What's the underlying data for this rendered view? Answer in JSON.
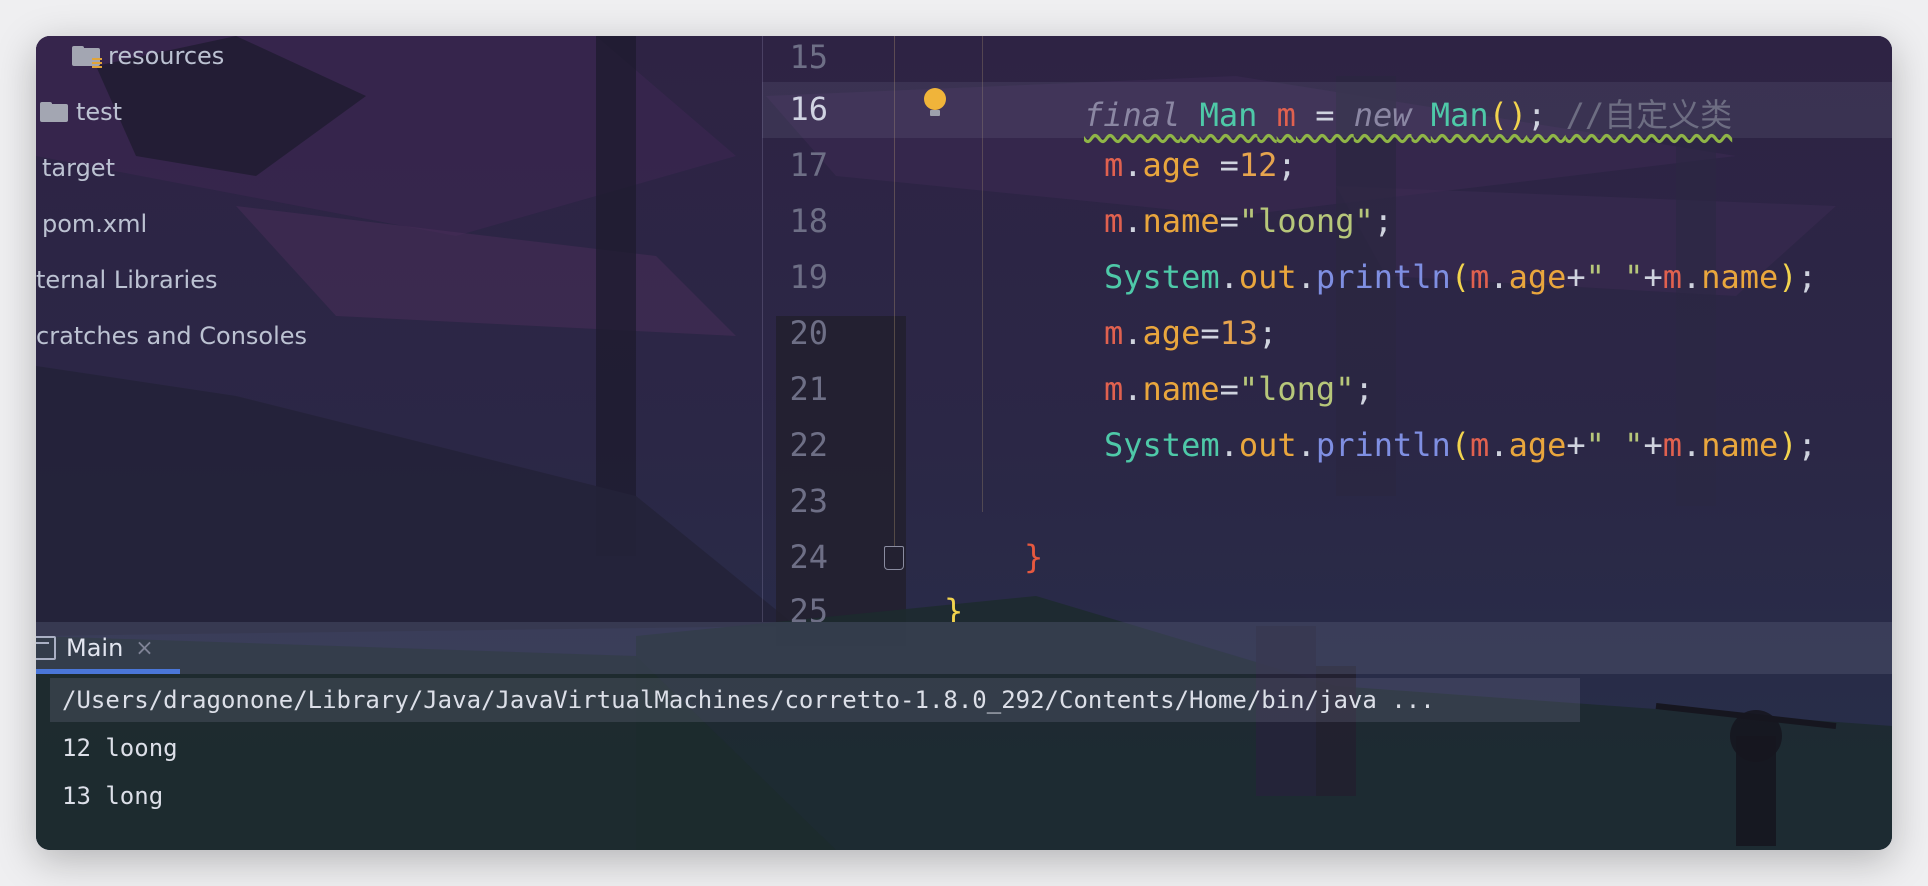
{
  "project_tree": {
    "items": [
      {
        "label": "resources",
        "icon": "resources-folder-icon"
      },
      {
        "label": "test",
        "icon": "folder-icon"
      },
      {
        "label": "target",
        "icon": ""
      },
      {
        "label": "pom.xml",
        "icon": ""
      },
      {
        "label": "ternal Libraries",
        "icon": ""
      },
      {
        "label": "cratches and Consoles",
        "icon": ""
      }
    ]
  },
  "editor": {
    "current_line": "16",
    "lines": [
      {
        "num": "15"
      },
      {
        "num": "16",
        "tokens": [
          "final",
          " ",
          "Man",
          " ",
          "m",
          " = ",
          "new",
          " ",
          "Man",
          "()",
          "; ",
          "//自定义类"
        ]
      },
      {
        "num": "17",
        "tokens": [
          "m",
          ".",
          "age",
          " =",
          "12",
          ";"
        ]
      },
      {
        "num": "18",
        "tokens": [
          "m",
          ".",
          "name",
          "=",
          "\"loong\"",
          ";"
        ]
      },
      {
        "num": "19",
        "tokens": [
          "System",
          ".",
          "out",
          ".",
          "println",
          "(",
          "m",
          ".",
          "age",
          "+",
          "\" \"",
          "+",
          "m",
          ".",
          "name",
          ")",
          ";"
        ]
      },
      {
        "num": "20",
        "tokens": [
          "m",
          ".",
          "age",
          "=",
          "13",
          ";"
        ]
      },
      {
        "num": "21",
        "tokens": [
          "m",
          ".",
          "name",
          "=",
          "\"long\"",
          ";"
        ]
      },
      {
        "num": "22",
        "tokens": [
          "System",
          ".",
          "out",
          ".",
          "println",
          "(",
          "m",
          ".",
          "age",
          "+",
          "\" \"",
          "+",
          "m",
          ".",
          "name",
          ")",
          ";"
        ]
      },
      {
        "num": "23"
      },
      {
        "num": "24",
        "tokens": [
          "}"
        ]
      },
      {
        "num": "25",
        "tokens": [
          "}"
        ]
      }
    ]
  },
  "run_panel": {
    "tab_label": "Main",
    "close_glyph": "×",
    "console_lines": [
      "/Users/dragonone/Library/Java/JavaVirtualMachines/corretto-1.8.0_292/Contents/Home/bin/java ...",
      "12 loong",
      "13 long"
    ]
  },
  "colors": {
    "keyword": "#8b87a3",
    "class": "#4ec9a8",
    "variable": "#e0614f",
    "number": "#e6a44e",
    "string": "#b7c77a",
    "method": "#7f8fe2",
    "field": "#e9a63d",
    "comment": "#6d6d82",
    "paren": "#f2d44e",
    "run_tab_accent": "#4a76d8"
  }
}
